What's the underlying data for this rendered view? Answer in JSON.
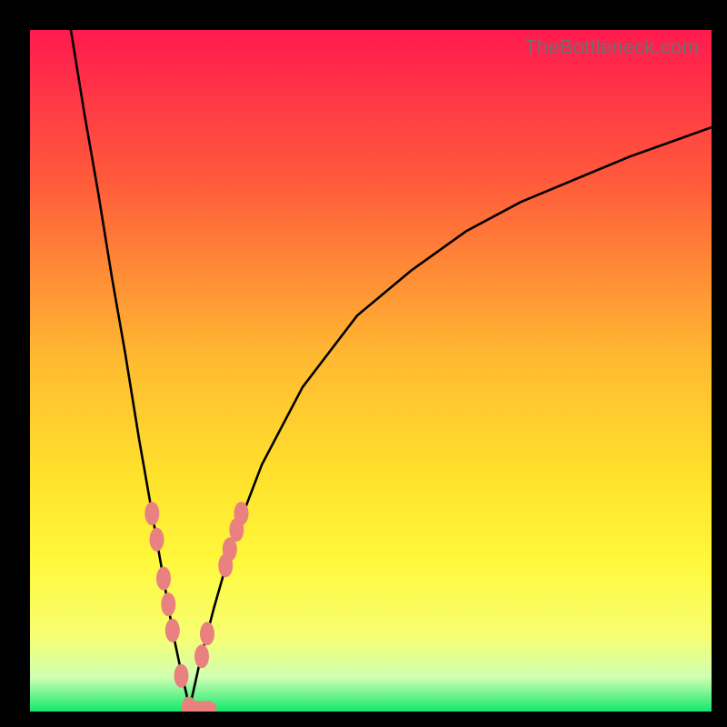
{
  "watermark": "TheBottleneck.com",
  "colors": {
    "top": "#ff1a4e",
    "mid1": "#ff5a3b",
    "mid2": "#ffb931",
    "mid3": "#ffe22c",
    "mid4": "#fff83c",
    "low1": "#f7ff72",
    "low2": "#cfffb2",
    "bottom": "#13e86b",
    "curve": "#000000",
    "marker": "#e8817f"
  },
  "chart_data": {
    "type": "line",
    "title": "",
    "xlabel": "",
    "ylabel": "",
    "xlim": [
      0,
      100
    ],
    "ylim": [
      0,
      105
    ],
    "notch_x": 23.3,
    "series": [
      {
        "name": "left-branch",
        "x": [
          6.0,
          8.0,
          10.0,
          12.0,
          14.0,
          16.0,
          17.5,
          19.0,
          20.0,
          21.0,
          22.0,
          23.0,
          23.3
        ],
        "values": [
          105.0,
          92.0,
          80.0,
          67.0,
          55.0,
          42.0,
          33.0,
          24.0,
          18.0,
          12.0,
          7.0,
          2.5,
          0.0
        ]
      },
      {
        "name": "right-branch",
        "x": [
          23.3,
          25.0,
          27.0,
          30.0,
          34.0,
          40.0,
          48.0,
          56.0,
          64.0,
          72.0,
          80.0,
          88.0,
          96.0,
          100.0
        ],
        "values": [
          0.0,
          8.0,
          16.0,
          27.0,
          38.0,
          50.0,
          61.0,
          68.0,
          74.0,
          78.5,
          82.0,
          85.5,
          88.5,
          90.0
        ]
      }
    ],
    "markers_left": [
      {
        "x": 17.9,
        "y": 30.5
      },
      {
        "x": 18.6,
        "y": 26.5
      },
      {
        "x": 19.6,
        "y": 20.5
      },
      {
        "x": 20.3,
        "y": 16.5
      },
      {
        "x": 20.9,
        "y": 12.5
      },
      {
        "x": 22.2,
        "y": 5.5
      },
      {
        "x": 23.3,
        "y": 0.5
      }
    ],
    "markers_right": [
      {
        "x": 25.2,
        "y": 8.5
      },
      {
        "x": 26.0,
        "y": 12.0
      },
      {
        "x": 28.7,
        "y": 22.5
      },
      {
        "x": 29.3,
        "y": 25.0
      },
      {
        "x": 30.3,
        "y": 28.0
      },
      {
        "x": 31.0,
        "y": 30.5
      }
    ],
    "markers_bottom": [
      {
        "x": 24.4,
        "y": 0.5
      },
      {
        "x": 25.3,
        "y": 0.5
      },
      {
        "x": 26.2,
        "y": 0.5
      }
    ]
  }
}
